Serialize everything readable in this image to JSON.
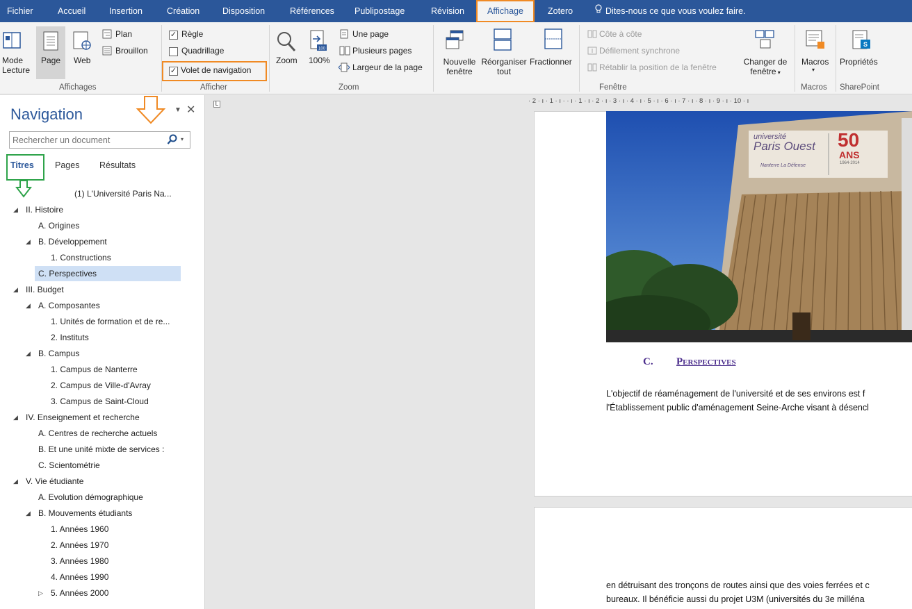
{
  "tabs": [
    {
      "label": "Fichier"
    },
    {
      "label": "Accueil"
    },
    {
      "label": "Insertion"
    },
    {
      "label": "Création"
    },
    {
      "label": "Disposition"
    },
    {
      "label": "Références"
    },
    {
      "label": "Publipostage"
    },
    {
      "label": "Révision"
    },
    {
      "label": "Affichage"
    },
    {
      "label": "Zotero"
    }
  ],
  "tell_me": "Dites-nous ce que vous voulez faire.",
  "ribbon": {
    "affichages": {
      "mode_lecture_1": "Mode",
      "mode_lecture_2": "Lecture",
      "page": "Page",
      "web": "Web",
      "plan": "Plan",
      "brouillon": "Brouillon",
      "group": "Affichages"
    },
    "afficher": {
      "regle": "Règle",
      "quadrillage": "Quadrillage",
      "volet": "Volet de navigation",
      "group": "Afficher",
      "regle_checked": true,
      "quadrillage_checked": false,
      "volet_checked": true
    },
    "zoom": {
      "zoom": "Zoom",
      "cent": "100%",
      "une_page": "Une page",
      "plusieurs_pages": "Plusieurs pages",
      "largeur": "Largeur de la page",
      "group": "Zoom"
    },
    "fenetre": {
      "nouvelle_1": "Nouvelle",
      "nouvelle_2": "fenêtre",
      "reorganiser_1": "Réorganiser",
      "reorganiser_2": "tout",
      "fractionner": "Fractionner",
      "cote": "Côte à côte",
      "defilement": "Défilement synchrone",
      "retablir": "Rétablir la position de la fenêtre",
      "changer_1": "Changer de",
      "changer_2": "fenêtre",
      "group": "Fenêtre"
    },
    "macros": {
      "label": "Macros",
      "group": "Macros"
    },
    "sharepoint": {
      "label": "Propriétés",
      "group": "SharePoint"
    }
  },
  "nav": {
    "title": "Navigation",
    "search_placeholder": "Rechercher un document",
    "tabs": {
      "titres": "Titres",
      "pages": "Pages",
      "resultats": "Résultats"
    },
    "items": [
      {
        "text": "(1) L'Université Paris Na..."
      },
      {
        "text": "II. Histoire"
      },
      {
        "text": "A. Origines"
      },
      {
        "text": "B. Développement"
      },
      {
        "text": "1. Constructions"
      },
      {
        "text": "C. Perspectives"
      },
      {
        "text": "III. Budget"
      },
      {
        "text": "A. Composantes"
      },
      {
        "text": "1. Unités de formation et de re..."
      },
      {
        "text": "2. Instituts"
      },
      {
        "text": "B. Campus"
      },
      {
        "text": "1. Campus de Nanterre"
      },
      {
        "text": "2. Campus de Ville-d'Avray"
      },
      {
        "text": "3. Campus de Saint-Cloud"
      },
      {
        "text": "IV. Enseignement et recherche"
      },
      {
        "text": "A. Centres de recherche actuels"
      },
      {
        "text": "B. Et une unité mixte de services :"
      },
      {
        "text": "C. Scientométrie"
      },
      {
        "text": "V. Vie étudiante"
      },
      {
        "text": "A. Evolution démographique"
      },
      {
        "text": "B. Mouvements étudiants"
      },
      {
        "text": "1. Années 1960"
      },
      {
        "text": "2. Années 1970"
      },
      {
        "text": "3. Années 1980"
      },
      {
        "text": "4. Années 1990"
      },
      {
        "text": "5. Années 2000"
      }
    ]
  },
  "document": {
    "ruler": "· 2 · ı · 1 · ı ·  · ı · 1 · ı · 2 · ı · 3 · ı · 4 · ı · 5 · ı · 6 · ı · 7 · ı · 8 · ı · 9 · ı · 10 · ı",
    "image": {
      "line1": "université",
      "line2": "Paris Ouest",
      "line3": "Nanterre La Défense",
      "num": "50",
      "ans": "ANS",
      "years": "1964-2014"
    },
    "heading_num": "C.",
    "heading_text": "Perspectives",
    "para1_line1": "L'objectif de réaménagement de l'université et de ses environs est f",
    "para1_line2": "l'Établissement public d'aménagement Seine-Arche visant à désencl",
    "para2_line1": "en détruisant des tronçons de routes ainsi que des voies ferrées et c",
    "para2_line2": "bureaux. Il bénéficie aussi du projet U3M (universités du 3e milléna"
  },
  "colors": {
    "ribbon_blue": "#2b579a",
    "highlight_orange": "#f08a24",
    "highlight_green": "#2ea34a",
    "selected_item": "#cfe0f5",
    "heading_purple": "#4b2d8c"
  }
}
